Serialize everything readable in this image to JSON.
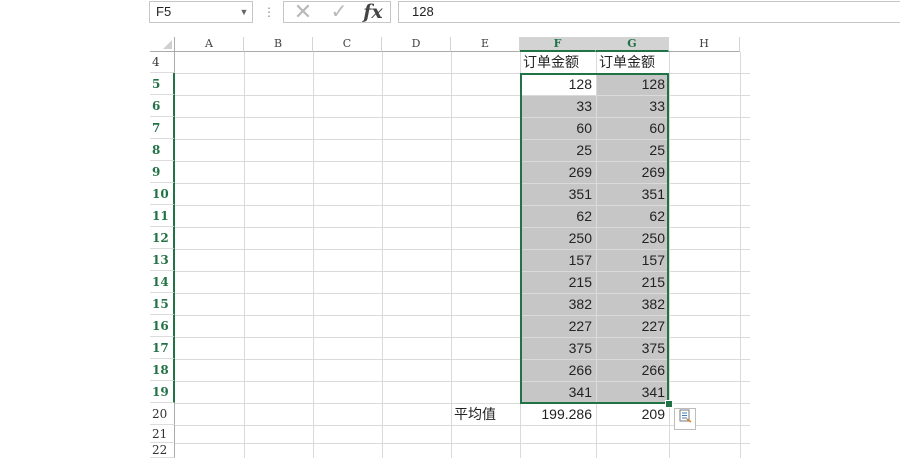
{
  "formula_bar": {
    "name_box": "F5",
    "name_box_dropdown": "▼",
    "grip": "⋮",
    "cancel": "✕",
    "enter": "✓",
    "fx": "fx",
    "formula": "128"
  },
  "columns": [
    "A",
    "B",
    "C",
    "D",
    "E",
    "F",
    "G",
    "H"
  ],
  "rows": {
    "r4": "4",
    "r5": "5",
    "r6": "6",
    "r7": "7",
    "r8": "8",
    "r9": "9",
    "r10": "10",
    "r11": "11",
    "r12": "12",
    "r13": "13",
    "r14": "14",
    "r15": "15",
    "r16": "16",
    "r17": "17",
    "r18": "18",
    "r19": "19",
    "r20": "20",
    "r21": "21",
    "r22": "22"
  },
  "cells": {
    "F4": "订单金额",
    "G4": "订单金额",
    "F": [
      "128",
      "33",
      "60",
      "25",
      "269",
      "351",
      "62",
      "250",
      "157",
      "215",
      "382",
      "227",
      "375",
      "266",
      "341"
    ],
    "G": [
      "128",
      "33",
      "60",
      "25",
      "269",
      "351",
      "62",
      "250",
      "157",
      "215",
      "382",
      "227",
      "375",
      "266",
      "341"
    ],
    "E20": "平均值",
    "F20": "199.286",
    "G20": "209"
  },
  "quick_analysis_icon": "quick-analysis",
  "accent_color": "#217346",
  "selection_color": "#c6c6c6"
}
